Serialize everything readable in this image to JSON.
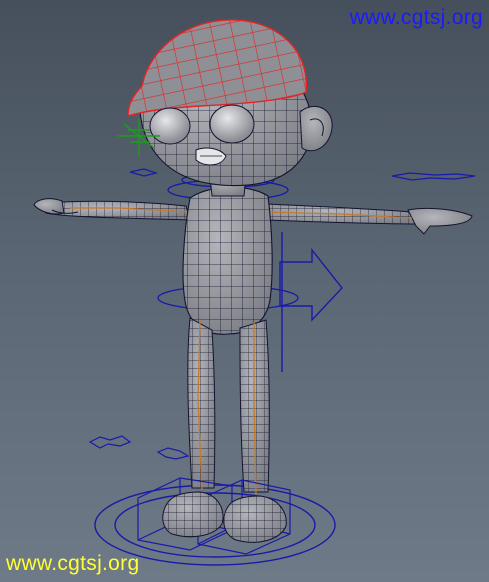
{
  "watermark_top": {
    "text": "www.cgtsj.org",
    "color": "#1a1aff"
  },
  "watermark_bottom": {
    "text": "www.cgtsj.org",
    "color": "#ffff33"
  },
  "colors": {
    "background_top": "#46505c",
    "background_bottom": "#6e7a87",
    "mesh_fill": "#9a9ca2",
    "wireframe": "#14142f",
    "cap_wireframe": "#e22424",
    "control_curves": "#1a1aa8",
    "joints": "#c47a2a",
    "locator": "#1c9c1c"
  },
  "icon_names": [
    "cap-mesh",
    "eye-mesh",
    "arrow-control",
    "foot-box-control",
    "ground-circle-control",
    "locator-icon"
  ]
}
